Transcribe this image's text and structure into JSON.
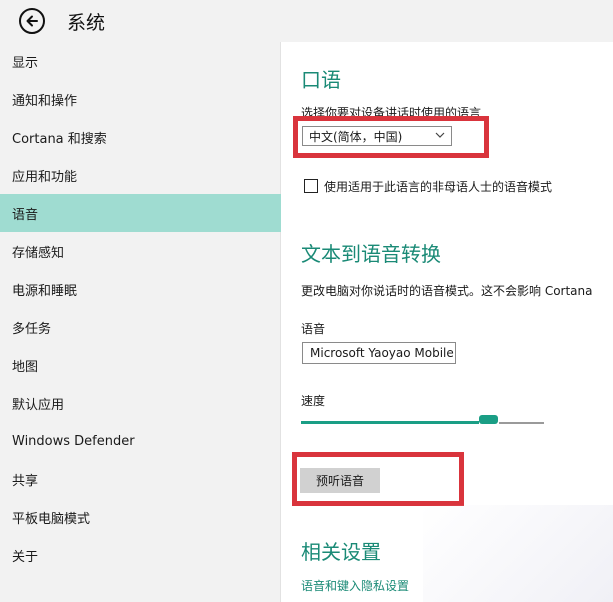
{
  "header": {
    "title": "系统"
  },
  "sidebar": {
    "items": [
      {
        "label": "显示"
      },
      {
        "label": "通知和操作"
      },
      {
        "label": "Cortana 和搜索"
      },
      {
        "label": "应用和功能"
      },
      {
        "label": "语音"
      },
      {
        "label": "存储感知"
      },
      {
        "label": "电源和睡眠"
      },
      {
        "label": "多任务"
      },
      {
        "label": "地图"
      },
      {
        "label": "默认应用"
      },
      {
        "label": "Windows Defender"
      },
      {
        "label": "共享"
      },
      {
        "label": "平板电脑模式"
      },
      {
        "label": "关于"
      }
    ],
    "active": "语音"
  },
  "main": {
    "speech": {
      "heading": "口语",
      "prompt": "选择你要对设备讲话时使用的语言",
      "language_value": "中文(简体，中国)",
      "non_native_checkbox_label": "使用适用于此语言的非母语人士的语音模式",
      "non_native_checked": false
    },
    "tts": {
      "heading": "文本到语音转换",
      "description": "更改电脑对你说话时的语音模式。这不会影响 Cortana",
      "voice_label": "语音",
      "voice_value": "Microsoft Yaoyao Mobile",
      "speed_label": "速度",
      "speed_level": 0.8,
      "preview_button": "预听语音"
    },
    "related": {
      "heading": "相关设置",
      "link": "语音和键入隐私设置"
    }
  },
  "colors": {
    "accent": "#1a8a76",
    "selected_nav": "#9fdcd1",
    "highlight_box": "#d9343c"
  }
}
